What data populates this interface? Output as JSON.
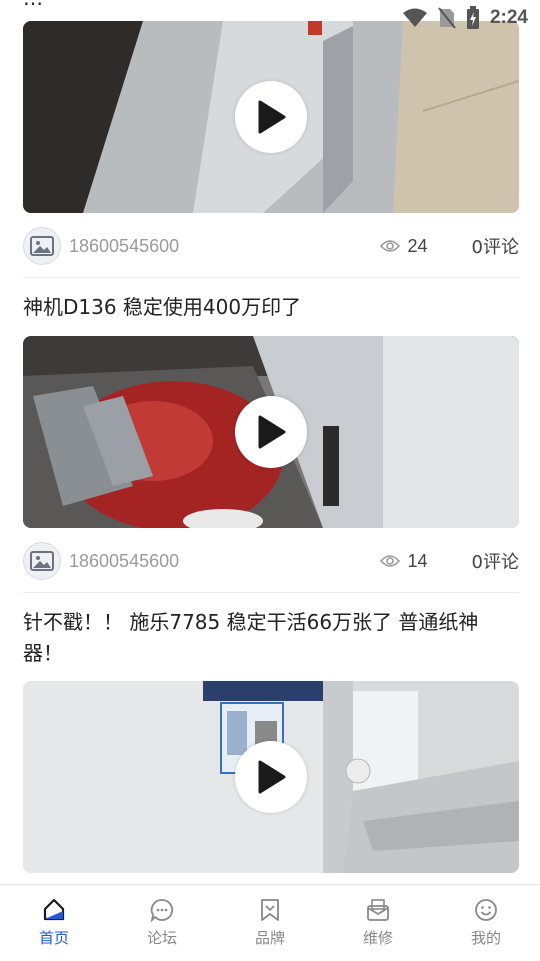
{
  "status_bar": {
    "time": "2:24"
  },
  "partial_post": {
    "title": "…"
  },
  "posts": [
    {
      "author": "18600545600",
      "views": "24",
      "comments": "0评论"
    },
    {
      "title": "神机D136 稳定使用400万印了",
      "author": "18600545600",
      "views": "14",
      "comments": "0评论"
    },
    {
      "title": "针不戳！！ 施乐7785 稳定干活66万张了 普通纸神器！"
    }
  ],
  "tab_bar": {
    "tabs": [
      {
        "label": "首页",
        "icon": "home-icon",
        "active": true
      },
      {
        "label": "论坛",
        "icon": "chat-bubble-icon",
        "active": false
      },
      {
        "label": "品牌",
        "icon": "bookmark-icon",
        "active": false
      },
      {
        "label": "维修",
        "icon": "mail-box-icon",
        "active": false
      },
      {
        "label": "我的",
        "icon": "smiley-icon",
        "active": false
      }
    ]
  },
  "colors": {
    "accent": "#1e5bd6",
    "muted_text": "#9a9a9a",
    "divider": "#ececec"
  }
}
